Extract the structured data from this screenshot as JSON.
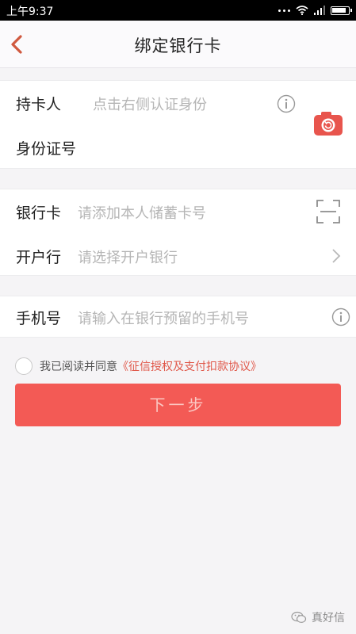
{
  "status_bar": {
    "time": "上午9:37"
  },
  "nav": {
    "title": "绑定银行卡",
    "back_icon": "chevron-left-icon"
  },
  "identity": {
    "cardholder_label": "持卡人",
    "cardholder_placeholder": "点击右侧认证身份",
    "id_label": "身份证号",
    "id_value": ""
  },
  "bank": {
    "card_label": "银行卡",
    "card_placeholder": "请添加本人储蓄卡号",
    "branch_label": "开户行",
    "branch_placeholder": "请选择开户银行"
  },
  "phone": {
    "label": "手机号",
    "placeholder": "请输入在银行预留的手机号"
  },
  "agreement": {
    "text": "我已阅读并同意",
    "link": "《征信授权及支付扣款协议》",
    "checked": false
  },
  "next_button": "下一步",
  "watermark": "真好信",
  "colors": {
    "accent": "#f35a55",
    "link": "#e0584a",
    "placeholder": "#b5b5b5",
    "page_bg": "#f5f4f6"
  }
}
